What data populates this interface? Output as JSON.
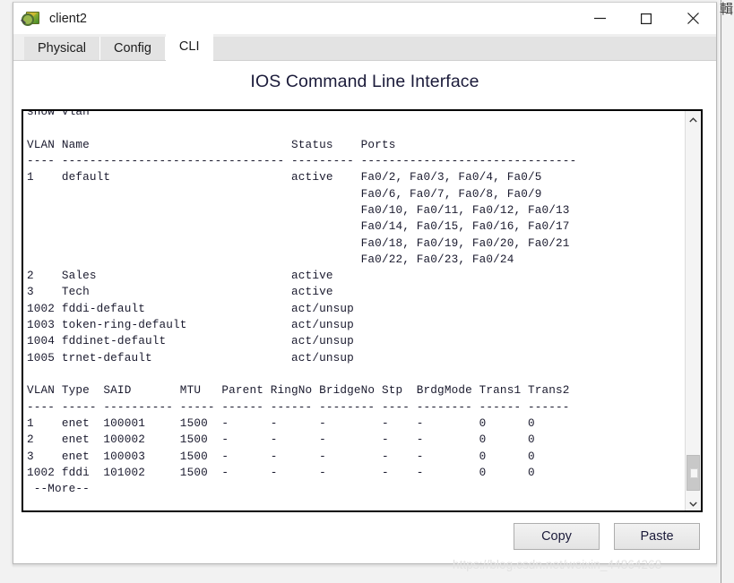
{
  "window": {
    "title": "client2",
    "icon": "packet-tracer-device-icon",
    "controls": {
      "minimize": "minimize-icon",
      "maximize": "maximize-icon",
      "close": "close-icon"
    }
  },
  "tabs": [
    {
      "label": "Physical",
      "active": false
    },
    {
      "label": "Config",
      "active": false
    },
    {
      "label": "CLI",
      "active": true
    }
  ],
  "dialog": {
    "heading": "IOS Command Line Interface"
  },
  "terminal": {
    "content": "show vlan\n\nVLAN Name                             Status    Ports\n---- -------------------------------- --------- -------------------------------\n1    default                          active    Fa0/2, Fa0/3, Fa0/4, Fa0/5\n                                                Fa0/6, Fa0/7, Fa0/8, Fa0/9\n                                                Fa0/10, Fa0/11, Fa0/12, Fa0/13\n                                                Fa0/14, Fa0/15, Fa0/16, Fa0/17\n                                                Fa0/18, Fa0/19, Fa0/20, Fa0/21\n                                                Fa0/22, Fa0/23, Fa0/24\n2    Sales                            active\n3    Tech                             active\n1002 fddi-default                     act/unsup\n1003 token-ring-default               act/unsup\n1004 fddinet-default                  act/unsup\n1005 trnet-default                    act/unsup\n\nVLAN Type  SAID       MTU   Parent RingNo BridgeNo Stp  BrdgMode Trans1 Trans2\n---- ----- ---------- ----- ------ ------ -------- ---- -------- ------ ------\n1    enet  100001     1500  -      -      -        -    -        0      0\n2    enet  100002     1500  -      -      -        -    -        0      0\n3    enet  100003     1500  -      -      -        -    -        0      0\n1002 fddi  101002     1500  -      -      -        -    -        0      0\n --More--",
    "command": "show vlan",
    "more_prompt": "--More--",
    "vlan_table": {
      "columns": [
        "VLAN",
        "Name",
        "Status",
        "Ports"
      ],
      "rows": [
        {
          "vlan": "1",
          "name": "default",
          "status": "active",
          "ports": [
            "Fa0/2, Fa0/3, Fa0/4, Fa0/5",
            "Fa0/6, Fa0/7, Fa0/8, Fa0/9",
            "Fa0/10, Fa0/11, Fa0/12, Fa0/13",
            "Fa0/14, Fa0/15, Fa0/16, Fa0/17",
            "Fa0/18, Fa0/19, Fa0/20, Fa0/21",
            "Fa0/22, Fa0/23, Fa0/24"
          ]
        },
        {
          "vlan": "2",
          "name": "Sales",
          "status": "active",
          "ports": []
        },
        {
          "vlan": "3",
          "name": "Tech",
          "status": "active",
          "ports": []
        },
        {
          "vlan": "1002",
          "name": "fddi-default",
          "status": "act/unsup",
          "ports": []
        },
        {
          "vlan": "1003",
          "name": "token-ring-default",
          "status": "act/unsup",
          "ports": []
        },
        {
          "vlan": "1004",
          "name": "fddinet-default",
          "status": "act/unsup",
          "ports": []
        },
        {
          "vlan": "1005",
          "name": "trnet-default",
          "status": "act/unsup",
          "ports": []
        }
      ]
    },
    "detail_table": {
      "columns": [
        "VLAN",
        "Type",
        "SAID",
        "MTU",
        "Parent",
        "RingNo",
        "BridgeNo",
        "Stp",
        "BrdgMode",
        "Trans1",
        "Trans2"
      ],
      "rows": [
        [
          "1",
          "enet",
          "100001",
          "1500",
          "-",
          "-",
          "-",
          "-",
          "-",
          "0",
          "0"
        ],
        [
          "2",
          "enet",
          "100002",
          "1500",
          "-",
          "-",
          "-",
          "-",
          "-",
          "0",
          "0"
        ],
        [
          "3",
          "enet",
          "100003",
          "1500",
          "-",
          "-",
          "-",
          "-",
          "-",
          "0",
          "0"
        ],
        [
          "1002",
          "fddi",
          "101002",
          "1500",
          "-",
          "-",
          "-",
          "-",
          "-",
          "0",
          "0"
        ]
      ]
    }
  },
  "scrollbar": {
    "up_arrow": "chevron-up-icon",
    "down_arrow": "chevron-down-icon"
  },
  "buttons": {
    "copy": "Copy",
    "paste": "Paste"
  },
  "watermark": {
    "text": "https://blog.csdn.net/weixin_44864268"
  },
  "desktop": {
    "right_strip_text": "輯"
  },
  "colors": {
    "terminal_text": "#1a1a2e",
    "terminal_border": "#000000",
    "heading": "#1b1b3a",
    "tab_active_bg": "#ffffff",
    "tab_inactive_bg": "#e3e3e3",
    "watermark": "#e2e2e2"
  }
}
